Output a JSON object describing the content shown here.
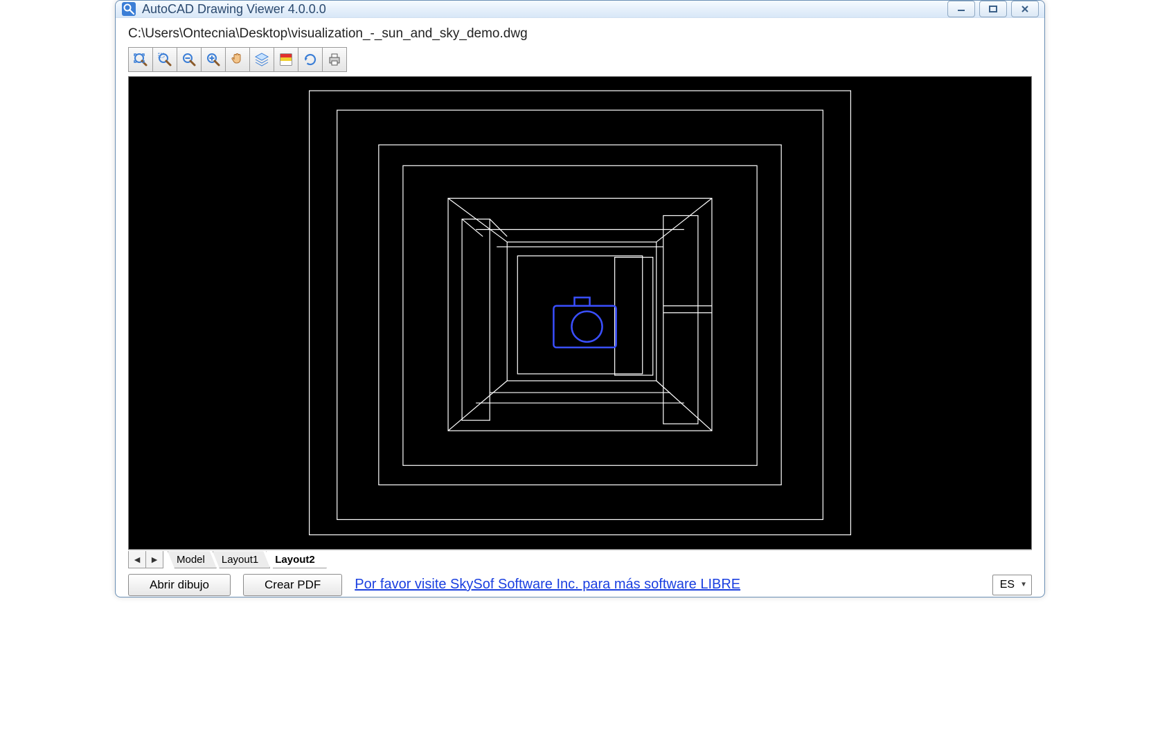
{
  "window": {
    "title": "AutoCAD Drawing Viewer 4.0.0.0"
  },
  "file_path": "C:\\Users\\Ontecnia\\Desktop\\visualization_-_sun_and_sky_demo.dwg",
  "toolbar": {
    "items": [
      {
        "name": "zoom-extents",
        "icon": "zoom-extents"
      },
      {
        "name": "zoom-window",
        "icon": "zoom-window"
      },
      {
        "name": "zoom-out",
        "icon": "zoom-out"
      },
      {
        "name": "zoom-in",
        "icon": "zoom-in"
      },
      {
        "name": "pan",
        "icon": "hand"
      },
      {
        "name": "layers",
        "icon": "layers"
      },
      {
        "name": "properties",
        "icon": "properties"
      },
      {
        "name": "refresh",
        "icon": "refresh"
      },
      {
        "name": "print",
        "icon": "print"
      }
    ]
  },
  "tabs": {
    "items": [
      {
        "label": "Model",
        "active": false
      },
      {
        "label": "Layout1",
        "active": false
      },
      {
        "label": "Layout2",
        "active": true
      }
    ]
  },
  "bottom": {
    "open_label": "Abrir dibujo",
    "pdf_label": "Crear PDF",
    "link_text": "Por favor visite SkySof Software Inc. para más software LIBRE",
    "language": "ES"
  },
  "colors": {
    "canvas_bg": "#000000",
    "wire": "#ffffff",
    "camera": "#3a4fff",
    "link": "#1a3fe0"
  }
}
